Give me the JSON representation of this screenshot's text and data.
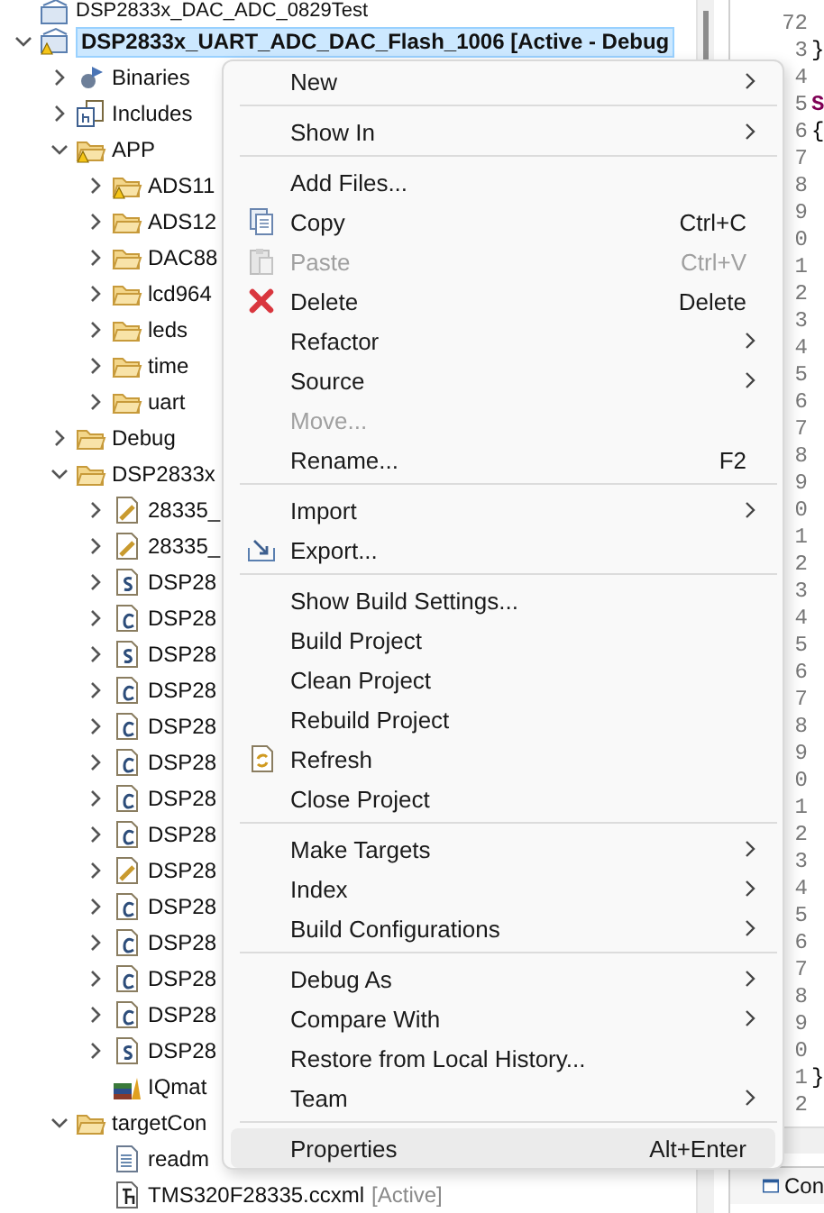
{
  "tree": [
    {
      "label": "DSP2833x_DAC_ADC_0829Test",
      "kind": "project",
      "selected": false
    },
    {
      "label": "DSP2833x_UART_ADC_DAC_Flash_1006  [Active - Debug",
      "kind": "project",
      "selected": true,
      "expanded": true,
      "warning": true,
      "children": [
        {
          "label": "Binaries",
          "kind": "binaries",
          "selected": false,
          "expanded": false
        },
        {
          "label": "Includes",
          "kind": "includes",
          "selected": false,
          "expanded": false
        },
        {
          "label": "APP",
          "kind": "folder",
          "selected": false,
          "expanded": true,
          "warning": true,
          "children": [
            {
              "label": "ADS11",
              "kind": "folder",
              "selected": false,
              "expanded": false,
              "warning": true
            },
            {
              "label": "ADS12",
              "kind": "folder",
              "selected": false,
              "expanded": false
            },
            {
              "label": "DAC88",
              "kind": "folder",
              "selected": false,
              "expanded": false
            },
            {
              "label": "lcd964",
              "kind": "folder",
              "selected": false,
              "expanded": false
            },
            {
              "label": "leds",
              "kind": "folder",
              "selected": false,
              "expanded": false
            },
            {
              "label": "time",
              "kind": "folder",
              "selected": false,
              "expanded": false
            },
            {
              "label": "uart",
              "kind": "folder",
              "selected": false,
              "expanded": false
            }
          ]
        },
        {
          "label": "Debug",
          "kind": "folder",
          "selected": false,
          "expanded": false
        },
        {
          "label": "DSP2833x",
          "kind": "folder",
          "selected": false,
          "expanded": true,
          "children": [
            {
              "label": "28335_",
              "kind": "linked",
              "selected": false,
              "expanded": false
            },
            {
              "label": "28335_",
              "kind": "linked",
              "selected": false,
              "expanded": false
            },
            {
              "label": "DSP28",
              "kind": "asm",
              "selected": false,
              "expanded": false
            },
            {
              "label": "DSP28",
              "kind": "c",
              "selected": false,
              "expanded": false
            },
            {
              "label": "DSP28",
              "kind": "asm",
              "selected": false,
              "expanded": false
            },
            {
              "label": "DSP28",
              "kind": "c",
              "selected": false,
              "expanded": false
            },
            {
              "label": "DSP28",
              "kind": "c",
              "selected": false,
              "expanded": false
            },
            {
              "label": "DSP28",
              "kind": "c",
              "selected": false,
              "expanded": false
            },
            {
              "label": "DSP28",
              "kind": "c",
              "selected": false,
              "expanded": false
            },
            {
              "label": "DSP28",
              "kind": "c",
              "selected": false,
              "expanded": false
            },
            {
              "label": "DSP28",
              "kind": "linked",
              "selected": false,
              "expanded": false
            },
            {
              "label": "DSP28",
              "kind": "c",
              "selected": false,
              "expanded": false
            },
            {
              "label": "DSP28",
              "kind": "c",
              "selected": false,
              "expanded": false
            },
            {
              "label": "DSP28",
              "kind": "c",
              "selected": false,
              "expanded": false
            },
            {
              "label": "DSP28",
              "kind": "c",
              "selected": false,
              "expanded": false
            },
            {
              "label": "DSP28",
              "kind": "asm",
              "selected": false,
              "expanded": false
            },
            {
              "label": "IQmat",
              "kind": "library",
              "selected": false
            }
          ]
        },
        {
          "label": "targetCon",
          "kind": "folder",
          "selected": false,
          "expanded": true,
          "children": [
            {
              "label": "readm",
              "kind": "text",
              "selected": false
            },
            {
              "label": "TMS320F28335.ccxml",
              "suffix": "[Active]",
              "kind": "ccxml",
              "selected": false
            }
          ]
        }
      ]
    }
  ],
  "editor": {
    "lines": [
      {
        "number": "72"
      },
      {
        "number": "3",
        "code": "}"
      },
      {
        "number": "4"
      },
      {
        "number": "5",
        "code": "S",
        "keyword": true
      },
      {
        "number": "6",
        "code": "{"
      },
      {
        "number": "7"
      },
      {
        "number": "8"
      },
      {
        "number": "9"
      },
      {
        "number": "0"
      },
      {
        "number": "1"
      },
      {
        "number": "2"
      },
      {
        "number": "3"
      },
      {
        "number": "4"
      },
      {
        "number": "5"
      },
      {
        "number": "6"
      },
      {
        "number": "7"
      },
      {
        "number": "8"
      },
      {
        "number": "9"
      },
      {
        "number": "0"
      },
      {
        "number": "1"
      },
      {
        "number": "2"
      },
      {
        "number": "3"
      },
      {
        "number": "4"
      },
      {
        "number": "5"
      },
      {
        "number": "6"
      },
      {
        "number": "7"
      },
      {
        "number": "8"
      },
      {
        "number": "9"
      },
      {
        "number": "0"
      },
      {
        "number": "1"
      },
      {
        "number": "2"
      },
      {
        "number": "3"
      },
      {
        "number": "4"
      },
      {
        "number": "5"
      },
      {
        "number": "6"
      },
      {
        "number": "7"
      },
      {
        "number": "8"
      },
      {
        "number": "9"
      },
      {
        "number": "0"
      },
      {
        "number": "1",
        "code": "}"
      },
      {
        "number": "2"
      }
    ],
    "console_tab": "Con"
  },
  "menu": {
    "items": [
      {
        "kind": "item",
        "label": "New",
        "submenu": true,
        "disabled": false,
        "selected": false
      },
      {
        "kind": "separator"
      },
      {
        "kind": "item",
        "label": "Show In",
        "submenu": true,
        "disabled": false,
        "selected": false
      },
      {
        "kind": "separator"
      },
      {
        "kind": "item",
        "label": "Add Files...",
        "submenu": false,
        "disabled": false,
        "selected": false
      },
      {
        "kind": "item",
        "label": "Copy",
        "shortcut": "Ctrl+C",
        "submenu": false,
        "disabled": false,
        "selected": false
      },
      {
        "kind": "item",
        "label": "Paste",
        "shortcut": "Ctrl+V",
        "submenu": false,
        "disabled": true,
        "selected": false
      },
      {
        "kind": "item",
        "label": "Delete",
        "shortcut": "Delete",
        "submenu": false,
        "disabled": false,
        "selected": false
      },
      {
        "kind": "item",
        "label": "Refactor",
        "submenu": true,
        "disabled": false,
        "selected": false
      },
      {
        "kind": "item",
        "label": "Source",
        "submenu": true,
        "disabled": false,
        "selected": false
      },
      {
        "kind": "item",
        "label": "Move...",
        "submenu": false,
        "disabled": true,
        "selected": false
      },
      {
        "kind": "item",
        "label": "Rename...",
        "shortcut": "F2",
        "submenu": false,
        "disabled": false,
        "selected": false
      },
      {
        "kind": "separator"
      },
      {
        "kind": "item",
        "label": "Import",
        "submenu": true,
        "disabled": false,
        "selected": false
      },
      {
        "kind": "item",
        "label": "Export...",
        "submenu": false,
        "disabled": false,
        "selected": false
      },
      {
        "kind": "separator"
      },
      {
        "kind": "item",
        "label": "Show Build Settings...",
        "submenu": false,
        "disabled": false,
        "selected": false
      },
      {
        "kind": "item",
        "label": "Build Project",
        "submenu": false,
        "disabled": false,
        "selected": false
      },
      {
        "kind": "item",
        "label": "Clean Project",
        "submenu": false,
        "disabled": false,
        "selected": false
      },
      {
        "kind": "item",
        "label": "Rebuild Project",
        "submenu": false,
        "disabled": false,
        "selected": false
      },
      {
        "kind": "item",
        "label": "Refresh",
        "submenu": false,
        "disabled": false,
        "selected": false
      },
      {
        "kind": "item",
        "label": "Close Project",
        "submenu": false,
        "disabled": false,
        "selected": false
      },
      {
        "kind": "separator"
      },
      {
        "kind": "item",
        "label": "Make Targets",
        "submenu": true,
        "disabled": false,
        "selected": false
      },
      {
        "kind": "item",
        "label": "Index",
        "submenu": true,
        "disabled": false,
        "selected": false
      },
      {
        "kind": "item",
        "label": "Build Configurations",
        "submenu": true,
        "disabled": false,
        "selected": false
      },
      {
        "kind": "separator"
      },
      {
        "kind": "item",
        "label": "Debug As",
        "submenu": true,
        "disabled": false,
        "selected": false
      },
      {
        "kind": "item",
        "label": "Compare With",
        "submenu": true,
        "disabled": false,
        "selected": false
      },
      {
        "kind": "item",
        "label": "Restore from Local History...",
        "submenu": false,
        "disabled": false,
        "selected": false
      },
      {
        "kind": "item",
        "label": "Team",
        "submenu": true,
        "disabled": false,
        "selected": false
      },
      {
        "kind": "separator"
      },
      {
        "kind": "item",
        "label": "Properties",
        "shortcut": "Alt+Enter",
        "submenu": false,
        "disabled": false,
        "selected": true
      }
    ]
  }
}
